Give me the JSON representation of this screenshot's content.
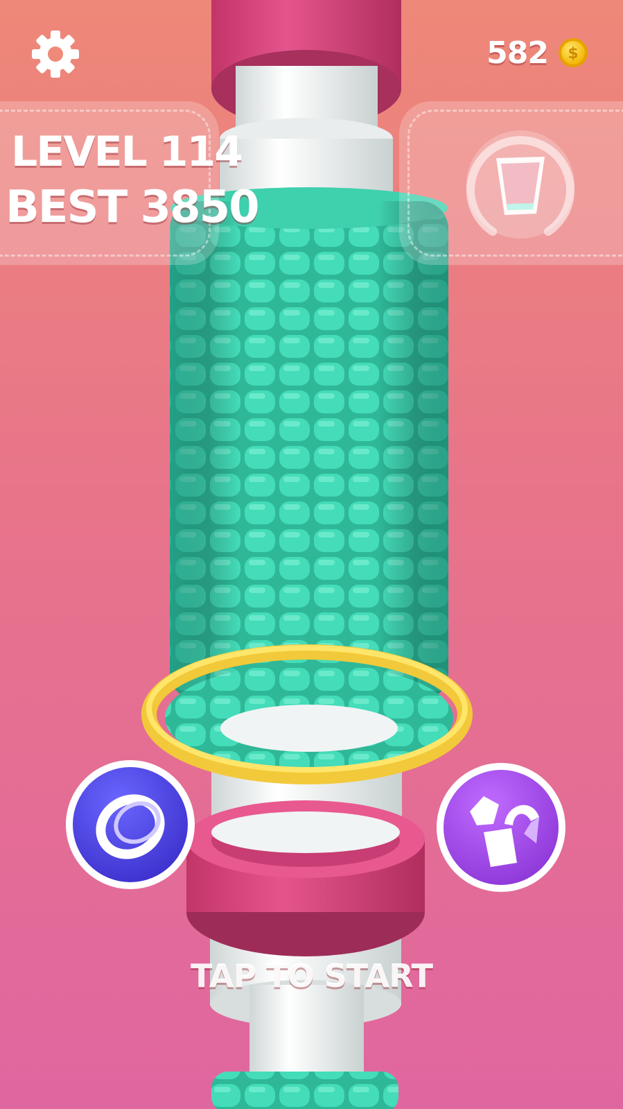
{
  "hud": {
    "coins": "582",
    "level_label": "LEVEL 114",
    "best_label": "BEST 3850"
  },
  "prompt": {
    "tap_to_start": "TAP TO START"
  },
  "icons": {
    "settings": "gear-icon",
    "coin": "coin-icon",
    "cup": "cup-icon",
    "ring_powerup": "ring-icon",
    "magnet_powerup": "magnet-icon"
  },
  "colors": {
    "background_top": "#ee8878",
    "background_bottom": "#e066a0",
    "corn_kernel": "#3fd6b4",
    "ring": "#f7d94a",
    "pink_collar": "#d9457e",
    "pole": "#f2f4f4",
    "ring_button": "#4a3fd6",
    "magnet_button": "#9b45e0"
  }
}
